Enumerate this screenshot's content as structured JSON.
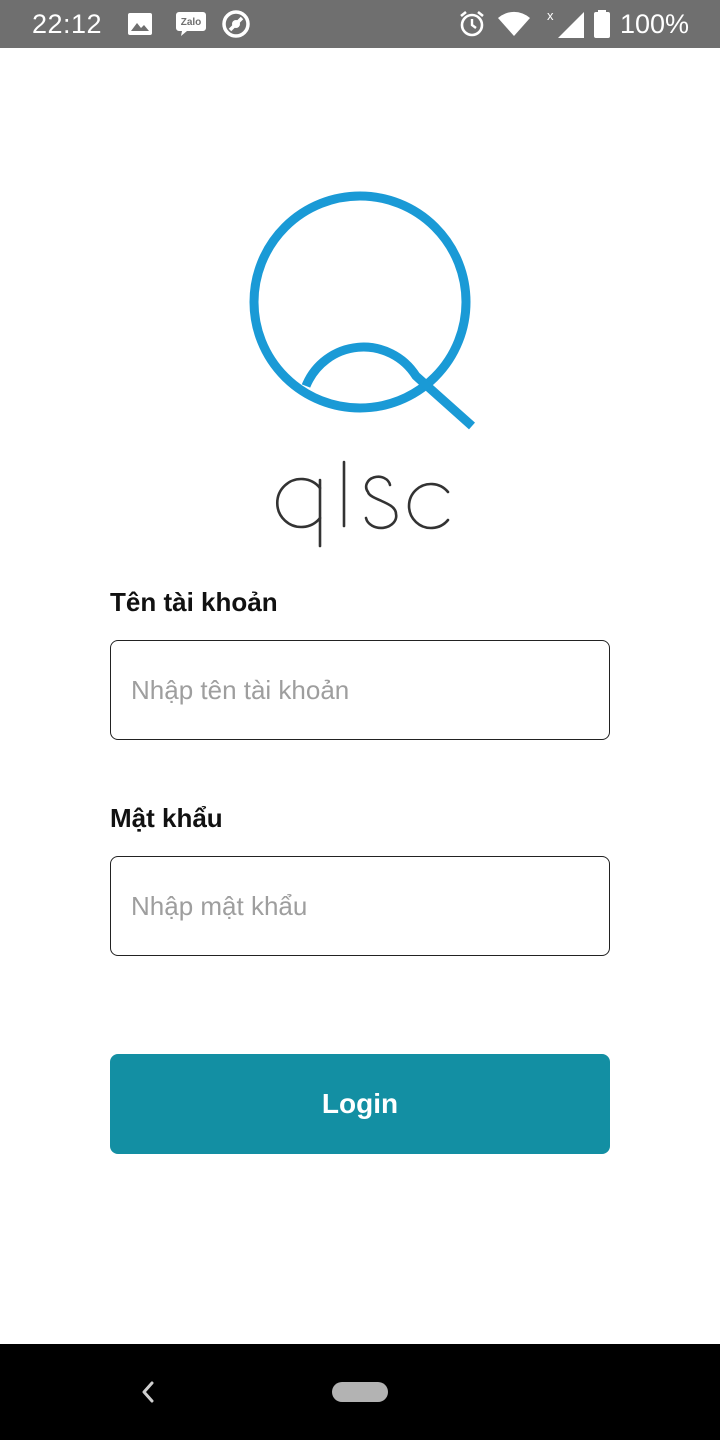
{
  "status_bar": {
    "time": "22:12",
    "battery_percent": "100%",
    "icons": [
      "image-icon",
      "zalo-icon",
      "circle-app-icon",
      "alarm-icon",
      "wifi-icon",
      "signal-icon",
      "battery-icon"
    ],
    "zalo_text": "Zalo"
  },
  "logo": {
    "text": "qlsc",
    "color": "#1a9ad6"
  },
  "form": {
    "username_label": "Tên tài khoản",
    "username_placeholder": "Nhập tên tài khoản",
    "username_value": "",
    "password_label": "Mật khẩu",
    "password_placeholder": "Nhập mật khẩu",
    "password_value": "",
    "login_label": "Login",
    "login_color": "#138fa3"
  },
  "nav_bar": {
    "icons": [
      "back-icon",
      "home-pill-icon"
    ]
  }
}
